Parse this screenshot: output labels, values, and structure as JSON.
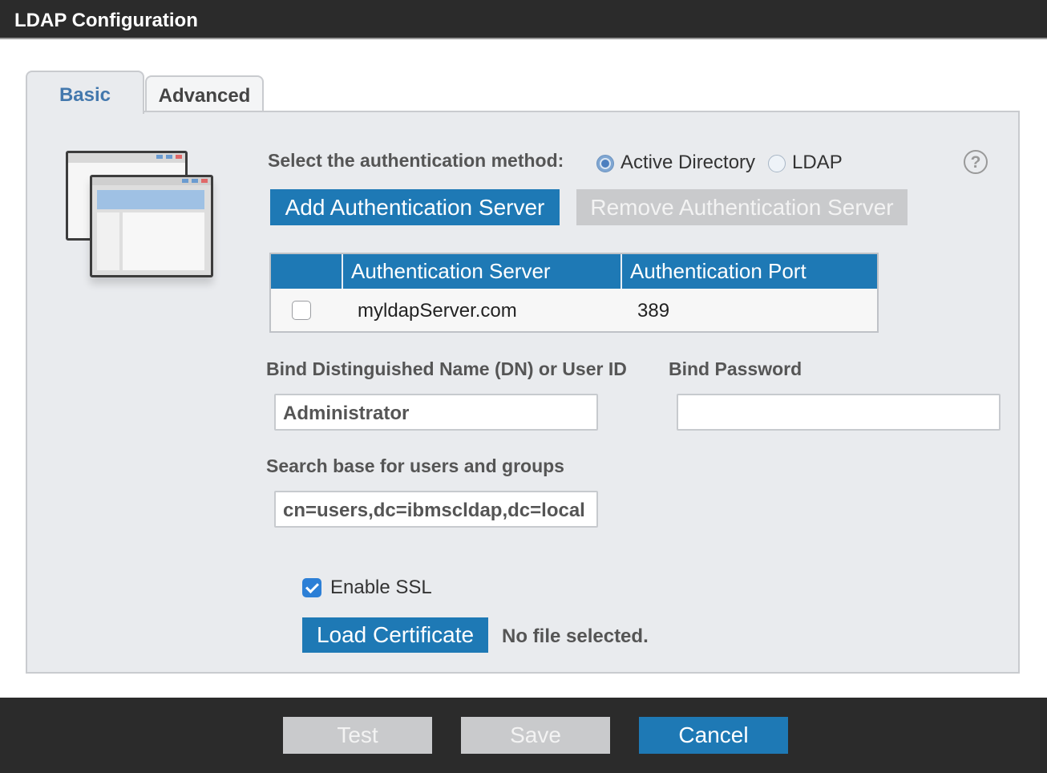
{
  "window": {
    "title": "LDAP Configuration"
  },
  "tabs": [
    {
      "label": "Basic",
      "active": true
    },
    {
      "label": "Advanced",
      "active": false
    }
  ],
  "auth_method": {
    "label": "Select the authentication method:",
    "options": [
      {
        "label": "Active Directory",
        "selected": true
      },
      {
        "label": "LDAP",
        "selected": false
      }
    ],
    "help_icon": "?"
  },
  "buttons": {
    "add_server": "Add Authentication Server",
    "remove_server": "Remove Authentication Server",
    "load_certificate": "Load Certificate"
  },
  "server_table": {
    "columns": [
      "Authentication Server",
      "Authentication Port"
    ],
    "rows": [
      {
        "checked": false,
        "server": "myldapServer.com",
        "port": "389"
      }
    ]
  },
  "fields": {
    "bind_dn": {
      "label": "Bind Distinguished Name (DN) or User ID",
      "value": "Administrator"
    },
    "bind_password": {
      "label": "Bind Password",
      "value": ""
    },
    "search_base": {
      "label": "Search base for users and groups",
      "value": "cn=users,dc=ibmscldap,dc=local"
    }
  },
  "ssl": {
    "label": "Enable SSL",
    "checked": true
  },
  "certificate": {
    "status": "No file selected."
  },
  "footer": {
    "test": "Test",
    "save": "Save",
    "cancel": "Cancel"
  },
  "colors": {
    "accent": "#1e79b5",
    "titlebar": "#2b2b2b",
    "panel": "#e9ebee",
    "disabled": "#c9cacc"
  },
  "icons": {
    "illustration": "window-stack-icon",
    "help": "help-icon",
    "checkbox": "checkbox-icon",
    "radio": "radio-icon"
  }
}
